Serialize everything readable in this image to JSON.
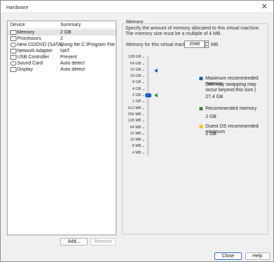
{
  "window": {
    "title": "Hardware",
    "close_glyph": "✕"
  },
  "device_list": {
    "col_device": "Device",
    "col_summary": "Summary",
    "items": [
      {
        "name": "Memory",
        "summary": "2 GB",
        "icon": "memory-icon",
        "selected": true
      },
      {
        "name": "Processors",
        "summary": "2",
        "icon": "processor-icon"
      },
      {
        "name": "New CD/DVD (SATA)",
        "summary": "Using file C:\\Program Files (x...",
        "icon": "cd-dvd-icon"
      },
      {
        "name": "Network Adapter",
        "summary": "NAT",
        "icon": "network-adapter-icon"
      },
      {
        "name": "USB Controller",
        "summary": "Present",
        "icon": "usb-controller-icon"
      },
      {
        "name": "Sound Card",
        "summary": "Auto detect",
        "icon": "sound-card-icon"
      },
      {
        "name": "Display",
        "summary": "Auto detect",
        "icon": "display-icon"
      }
    ]
  },
  "buttons": {
    "add": "Add...",
    "remove": "Remove",
    "close": "Close",
    "help": "Help"
  },
  "memory": {
    "group_title": "Memory",
    "description": "Specify the amount of memory allocated to this virtual machine. The memory size must be a multiple of 4 MB.",
    "field_label": "Memory for this virtual machine:",
    "value": "2048",
    "unit": "MB",
    "scale": [
      "128 GB",
      "64 GB",
      "32 GB",
      "16 GB",
      "8 GB",
      "4 GB",
      "2 GB",
      "1 GB",
      "512 MB",
      "256 MB",
      "128 MB",
      "64 MB",
      "32 MB",
      "16 MB",
      "8 MB",
      "4 MB"
    ],
    "legend": {
      "max_title": "Maximum recommended memory",
      "max_note": "(Memory swapping may occur beyond this size.)",
      "max_value": "27.4 GB",
      "rec_title": "Recommended memory",
      "rec_value": "2 GB",
      "guest_title": "Guest OS recommended minimum",
      "guest_value": "2 GB"
    },
    "colors": {
      "max": "#1565c0",
      "recommended": "#2f8f2f",
      "guest_min": "#f5c518"
    }
  }
}
